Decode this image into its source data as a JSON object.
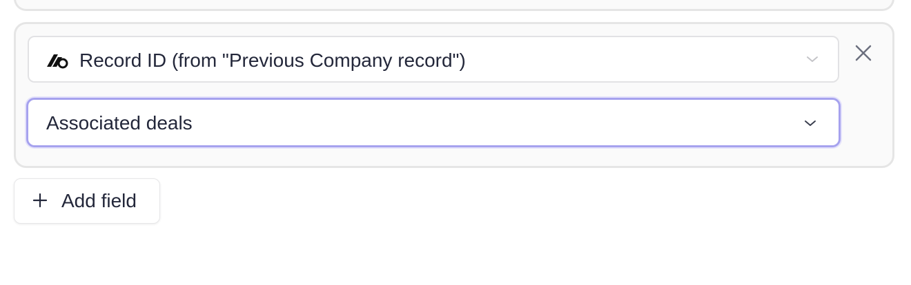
{
  "source_field": {
    "icon": "app-logo-icon",
    "label": "Record ID (from \"Previous Company record\")"
  },
  "target_field": {
    "label": "Associated deals",
    "focused": true
  },
  "actions": {
    "remove_icon": "close-icon",
    "add_field_label": "Add field",
    "add_field_icon": "plus-icon"
  },
  "colors": {
    "text": "#23273a",
    "focus_border": "#a6a2ee",
    "card_background": "#fafafa",
    "card_border": "#e5e5e5"
  }
}
